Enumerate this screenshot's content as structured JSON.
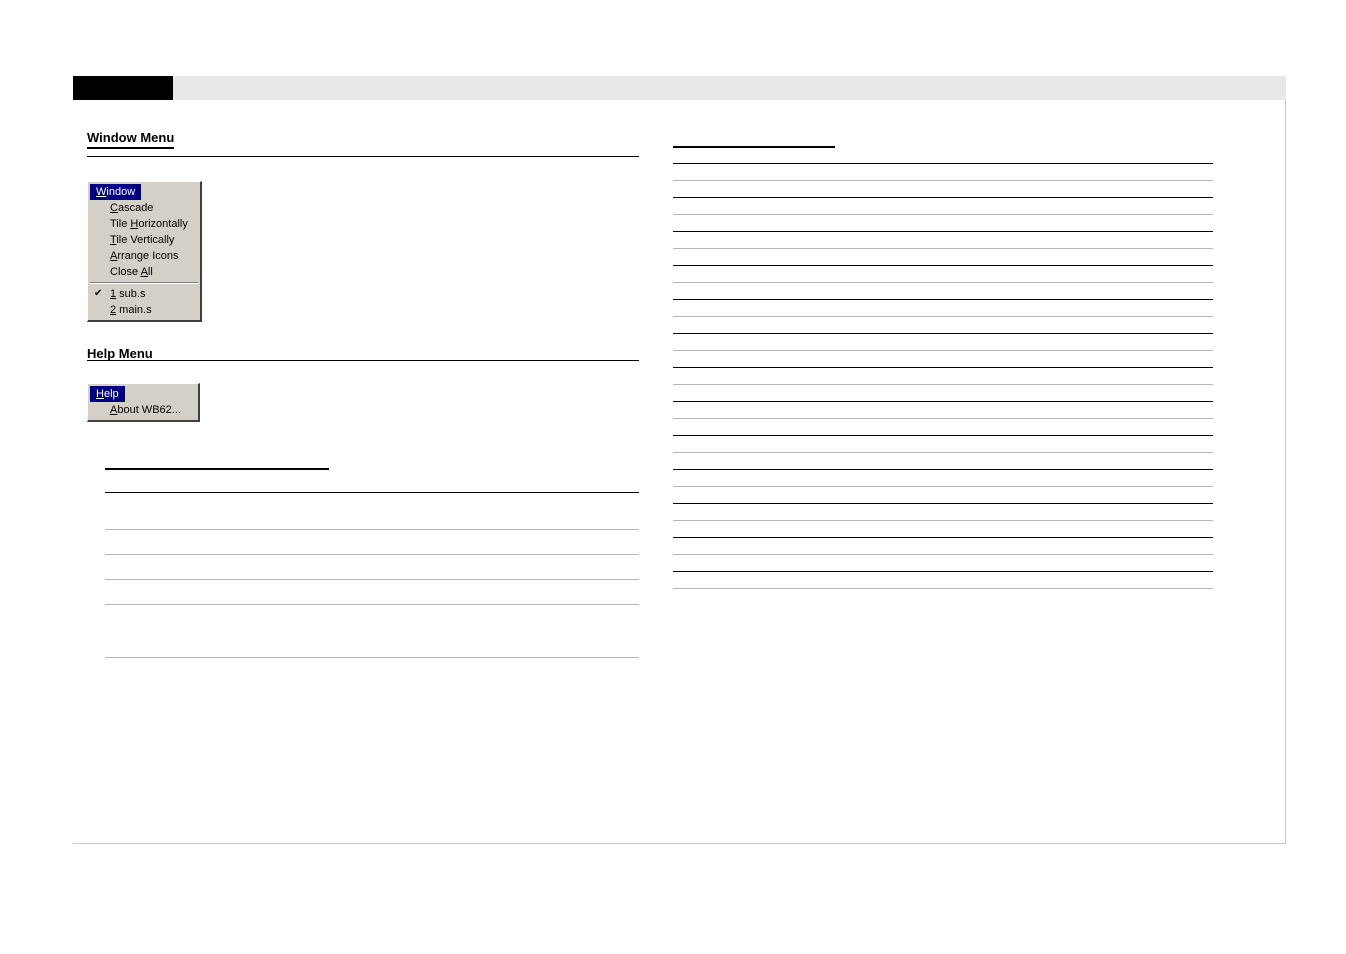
{
  "tab": {
    "label": " "
  },
  "left": {
    "section1": {
      "heading": "Window Menu",
      "menu_title": "Window",
      "items": [
        {
          "label": "Cascade",
          "mnemonic": "C",
          "checked": false
        },
        {
          "label": "Tile Horizontally",
          "mnemonic": "H",
          "checked": false
        },
        {
          "label": "Tile Vertically",
          "mnemonic": "T",
          "checked": false
        },
        {
          "label": "Arrange Icons",
          "mnemonic": "A",
          "checked": false
        },
        {
          "label": "Close All",
          "mnemonic": "A",
          "checked": false
        }
      ],
      "windows": [
        {
          "label": "1 sub.s",
          "mnemonic": "1",
          "checked": true
        },
        {
          "label": "2 main.s",
          "mnemonic": "2",
          "checked": false
        }
      ]
    },
    "section2": {
      "heading": "Help Menu",
      "menu_title": "Help",
      "items": [
        {
          "label": "About WB62...",
          "mnemonic": "A",
          "checked": false
        }
      ]
    },
    "section3": {
      "heading": " "
    }
  },
  "right": {
    "heading": " ",
    "link": " "
  }
}
